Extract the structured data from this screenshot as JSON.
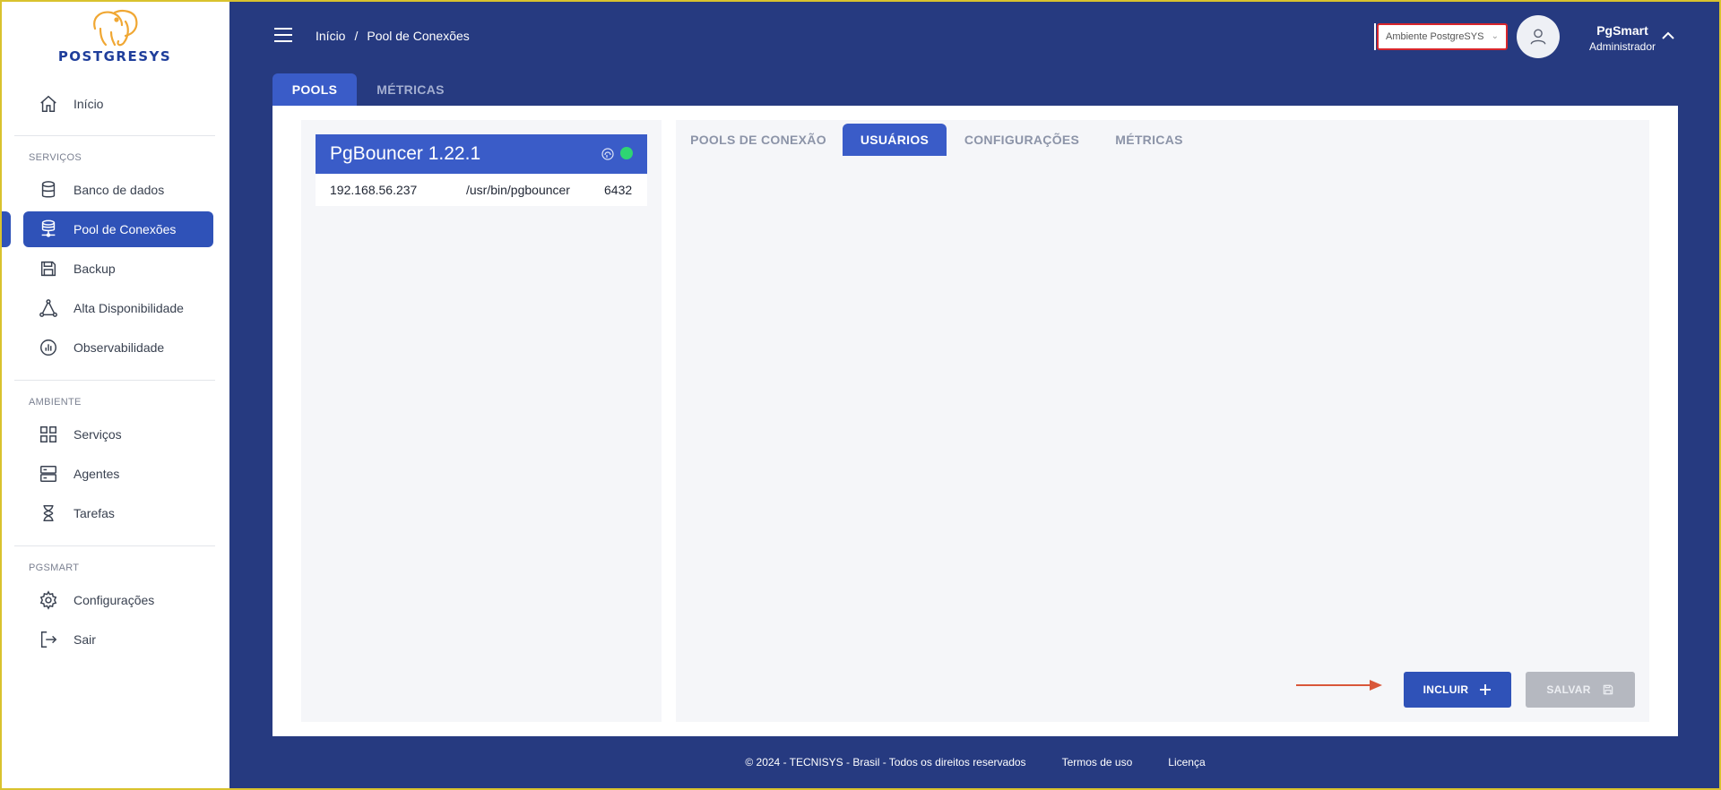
{
  "brand": {
    "name": "POSTGRESYS"
  },
  "sidebar": {
    "home": {
      "label": "Início"
    },
    "sections": [
      {
        "title": "SERVIÇOS"
      },
      {
        "title": "AMBIENTE"
      },
      {
        "title": "PGSMART"
      }
    ],
    "items": [
      {
        "label": "Banco de dados"
      },
      {
        "label": "Pool de Conexões"
      },
      {
        "label": "Backup"
      },
      {
        "label": "Alta Disponibilidade"
      },
      {
        "label": "Observabilidade"
      },
      {
        "label": "Serviços"
      },
      {
        "label": "Agentes"
      },
      {
        "label": "Tarefas"
      },
      {
        "label": "Configurações"
      },
      {
        "label": "Sair"
      }
    ]
  },
  "header": {
    "breadcrumb": {
      "home": "Início",
      "separator": "/",
      "current": "Pool de Conexões"
    },
    "environment": {
      "selected": "Ambiente PostgreSYS"
    },
    "user": {
      "name": "PgSmart",
      "role": "Administrador"
    }
  },
  "top_tabs": [
    {
      "label": "POOLS",
      "active": true
    },
    {
      "label": "MÉTRICAS",
      "active": false
    }
  ],
  "pool": {
    "title": "PgBouncer 1.22.1",
    "status": "online",
    "host": "192.168.56.237",
    "path": "/usr/bin/pgbouncer",
    "port": "6432"
  },
  "sub_tabs": [
    {
      "label": "POOLS DE CONEXÃO",
      "active": false
    },
    {
      "label": "USUÁRIOS",
      "active": true
    },
    {
      "label": "CONFIGURAÇÕES",
      "active": false
    },
    {
      "label": "MÉTRICAS",
      "active": false
    }
  ],
  "actions": {
    "include_label": "INCLUIR",
    "save_label": "SALVAR"
  },
  "footer": {
    "copyright": "© 2024 - TECNISYS - Brasil - Todos os direitos reservados",
    "terms": "Termos de uso",
    "license": "Licença"
  },
  "colors": {
    "primary": "#2f52b8",
    "header_bg": "#263a80",
    "status_ok": "#2ed573",
    "arrow": "#d9573a"
  }
}
